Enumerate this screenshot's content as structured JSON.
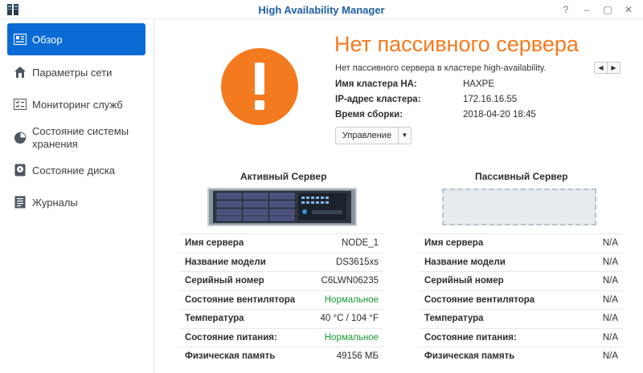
{
  "window": {
    "title": "High Availability Manager",
    "controls": {
      "help": "?",
      "minimize": "–",
      "maximize": "▢",
      "close": "✕"
    }
  },
  "sidebar": {
    "items": [
      {
        "label": "Обзор",
        "icon": "overview-icon",
        "active": true
      },
      {
        "label": "Параметры сети",
        "icon": "network-icon"
      },
      {
        "label": "Мониторинг служб",
        "icon": "service-monitor-icon"
      },
      {
        "label": "Состояние системы хранения",
        "icon": "storage-icon"
      },
      {
        "label": "Состояние диска",
        "icon": "disk-icon"
      },
      {
        "label": "Журналы",
        "icon": "logs-icon"
      }
    ]
  },
  "status": {
    "title": "Нет пассивного сервера",
    "description": "Нет пассивного сервера в кластере high-availability.",
    "icon": "warning-exclamation-icon",
    "color": "#f47a1f",
    "pager": {
      "prev": "◀",
      "next": "▶"
    }
  },
  "cluster_info": [
    {
      "label": "Имя кластера HA:",
      "value": "HAXPE"
    },
    {
      "label": "IP-адрес кластера:",
      "value": "172.16.16.55"
    },
    {
      "label": "Время сборки:",
      "value": "2018-04-20 18:45"
    }
  ],
  "manage_button": {
    "label": "Управление",
    "arrow": "▼"
  },
  "active_server": {
    "title": "Активный Сервер",
    "rows": [
      {
        "label": "Имя сервера",
        "value": "NODE_1"
      },
      {
        "label": "Название модели",
        "value": "DS3615xs"
      },
      {
        "label": "Серийный номер",
        "value": "C6LWN06235"
      },
      {
        "label": "Состояние вентилятора",
        "value": "Нормальное",
        "status": "ok"
      },
      {
        "label": "Температура",
        "value": "40 °C / 104 °F"
      },
      {
        "label": "Состояние питания:",
        "value": "Нормальное",
        "status": "ok"
      },
      {
        "label": "Физическая память",
        "value": "49156 МБ"
      }
    ]
  },
  "passive_server": {
    "title": "Пассивный Сервер",
    "rows": [
      {
        "label": "Имя сервера",
        "value": "N/A"
      },
      {
        "label": "Название модели",
        "value": "N/A"
      },
      {
        "label": "Серийный номер",
        "value": "N/A"
      },
      {
        "label": "Состояние вентилятора",
        "value": "N/A"
      },
      {
        "label": "Температура",
        "value": "N/A"
      },
      {
        "label": "Состояние питания:",
        "value": "N/A"
      },
      {
        "label": "Физическая память",
        "value": "N/A"
      }
    ]
  },
  "colors": {
    "accent": "#0a6bd5",
    "title": "#1f5fa8",
    "ok": "#1a9a38",
    "warning": "#f47a1f"
  }
}
